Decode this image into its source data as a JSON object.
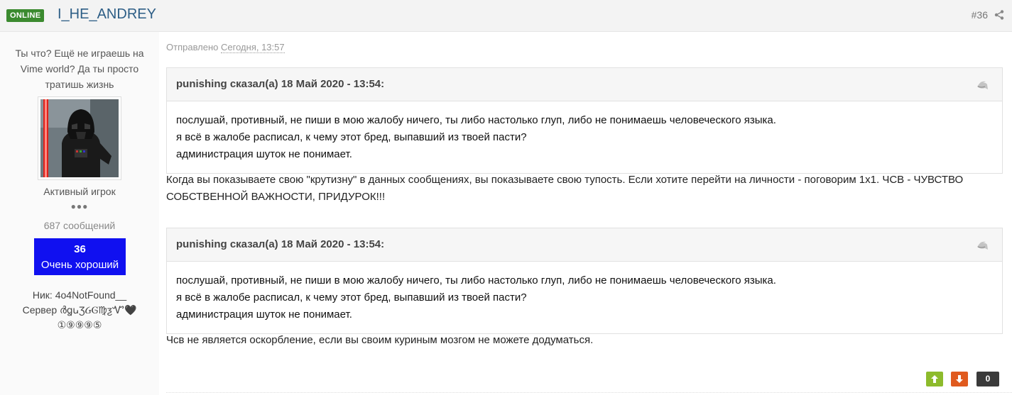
{
  "header": {
    "online_badge": "ONLINE",
    "author_name": "I_HE_ANDREY",
    "post_number": "#36",
    "share_icon": "share-icon"
  },
  "sidebar": {
    "custom_title": "Ты что? Ещё не играешь на Vime world? Да ты просто тратишь жизнь",
    "group": "Активный игрок",
    "pips": "●●●",
    "post_count": "687 сообщений",
    "reputation": {
      "value": "36",
      "label": "Очень хороший",
      "color": "#1010f0"
    },
    "fields": {
      "nick": "Ник: 4o4NotFound__",
      "server": "Сервер ർꬶꭎƷᏵᎶ♍ƺᏉ🖤",
      "server_line2": "①⑨⑨⑨⑤"
    }
  },
  "post": {
    "posted_prefix": "Отправлено",
    "posted_date": "Сегодня, 13:57",
    "quotes": [
      {
        "citation": "punishing сказал(а) 18 Май 2020 - 13:54:",
        "lines": [
          "послушай, противный, не пиши в мою жалобу ничего, ты либо настолько глуп, либо не понимаешь человеческого языка.",
          "я всё в жалобе расписал, к чему этот бред, выпавший из твоей пасти?",
          "администрация шуток не понимает."
        ]
      },
      {
        "citation": "punishing сказал(а) 18 Май 2020 - 13:54:",
        "lines": [
          "послушай, противный, не пиши в мою жалобу ничего, ты либо настолько глуп, либо не понимаешь человеческого языка.",
          "я всё в жалобе расписал, к чему этот бред, выпавший из твоей пасти?",
          "администрация шуток не понимает."
        ]
      }
    ],
    "reply_1": "Когда вы показываете свою \"крутизну\" в данных сообщениях, вы показываете свою тупость. Если хотите перейти на личности - поговорим 1х1. ЧСВ - ЧУВСТВО СОБСТВЕННОЙ ВАЖНОСТИ, ПРИДУРОК!!!",
    "reply_2": "Чсв не является оскорбление, если вы своим куриным мозгом не можете додуматься."
  },
  "footer": {
    "vote_up_icon": "arrow-up-icon",
    "vote_down_icon": "arrow-down-icon",
    "rep_count": "0",
    "colors": {
      "up": "#8dbb2c",
      "down": "#e05a1e",
      "count": "#3a3a3a"
    }
  }
}
